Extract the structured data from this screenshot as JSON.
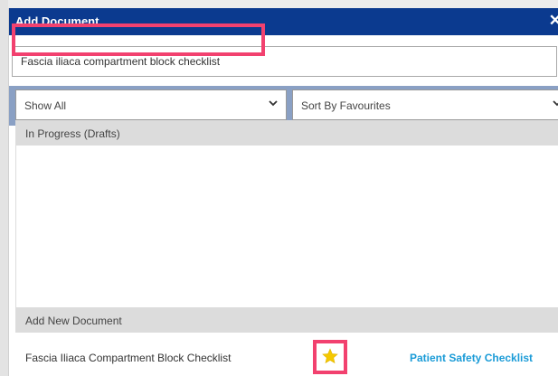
{
  "dialog": {
    "title": "Add Document",
    "close_glyph": "✕"
  },
  "search": {
    "value": "Fascia iliaca compartment block checklist"
  },
  "filters": {
    "show": {
      "selected": "Show All"
    },
    "sort": {
      "selected": "Sort By Favourites"
    }
  },
  "sections": {
    "drafts": {
      "label": "In Progress (Drafts)"
    },
    "new": {
      "label": "Add New Document"
    }
  },
  "documents": [
    {
      "name": "Fascia Iliaca Compartment Block Checklist",
      "category": "Patient Safety Checklist",
      "favourite": true
    }
  ],
  "colors": {
    "titlebar": "#0b3a8f",
    "highlight": "#f2416f",
    "star": "#f5c800",
    "category_link": "#1a9bd7",
    "filter_bar": "#8aa0c4",
    "section_header": "#dcdcdc"
  },
  "icons": {
    "close": "close-icon",
    "chevron": "chevron-down-icon",
    "star": "star-icon"
  }
}
